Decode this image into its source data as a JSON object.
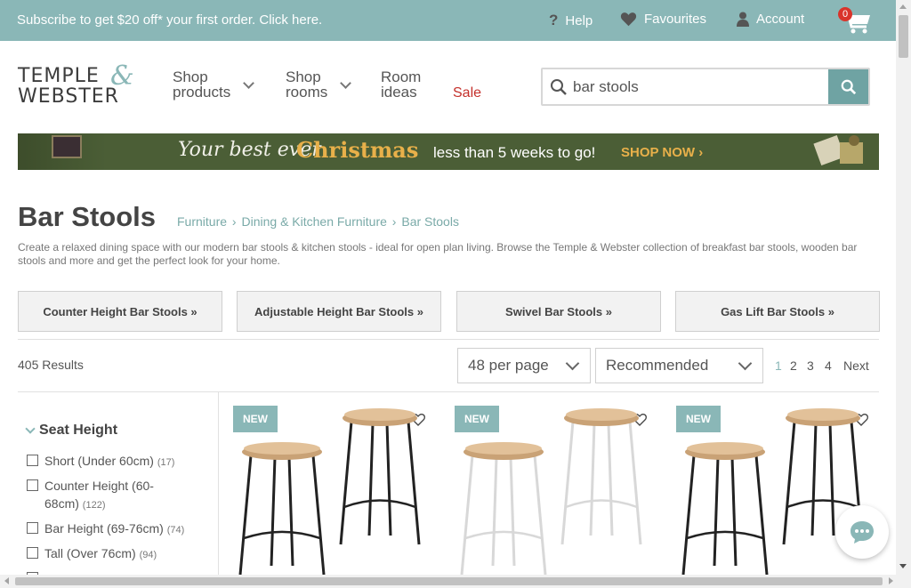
{
  "promo": {
    "text": "Subscribe to get $20 off* your first order. Click here.",
    "help": "Help",
    "favourites": "Favourites",
    "account": "Account",
    "cart_count": "0"
  },
  "header": {
    "logo_line1": "TEMPLE",
    "logo_line2": "WEBSTER",
    "logo_amp": "&",
    "nav": {
      "shop_products_1": "Shop",
      "shop_products_2": "products",
      "shop_rooms_1": "Shop",
      "shop_rooms_2": "rooms",
      "room_ideas_1": "Room",
      "room_ideas_2": "ideas",
      "sale": "Sale"
    },
    "search": {
      "value": "bar stools",
      "placeholder": "bar stools"
    }
  },
  "banner": {
    "script": "Your best ever",
    "highlight": "Christmas",
    "middle": "less than 5 weeks to go!",
    "cta": "SHOP NOW ›"
  },
  "page": {
    "title": "Bar Stools",
    "breadcrumb": [
      "Furniture",
      "Dining & Kitchen Furniture",
      "Bar Stools"
    ],
    "breadcrumb_sep": "›",
    "description": "Create a relaxed dining space with our modern bar stools & kitchen stools - ideal for open plan living. Browse the Temple & Webster collection of breakfast bar stools, wooden bar stools and more and get the perfect look for your home."
  },
  "categories": [
    "Counter Height Bar Stools  »",
    "Adjustable Height Bar Stools  »",
    "Swivel Bar Stools  »",
    "Gas Lift Bar Stools  »"
  ],
  "toolbar": {
    "results": "405 Results",
    "per_page": "48 per page",
    "sort": "Recommended",
    "pages": [
      "1",
      "2",
      "3",
      "4"
    ],
    "next": "Next"
  },
  "filters": {
    "title": "Seat Height",
    "items": [
      {
        "label": "Short (Under 60cm)",
        "count": "(17)"
      },
      {
        "label": "Counter Height (60-",
        "label2": "68cm)",
        "count": "(122)"
      },
      {
        "label": "Bar Height (69-76cm)",
        "count": "(74)"
      },
      {
        "label": "Tall (Over 76cm)",
        "count": "(94)"
      }
    ]
  },
  "products": [
    {
      "badge": "NEW",
      "frame_color": "#222222"
    },
    {
      "badge": "NEW",
      "frame_color": "#f4f4f4"
    },
    {
      "badge": "NEW",
      "frame_color": "#222222"
    }
  ],
  "colors": {
    "accent": "#8ab7b7",
    "sale": "#c4302b",
    "search_button": "#6fa3a3",
    "banner_bg": "#4b5e36",
    "banner_highlight": "#e8b04a"
  }
}
